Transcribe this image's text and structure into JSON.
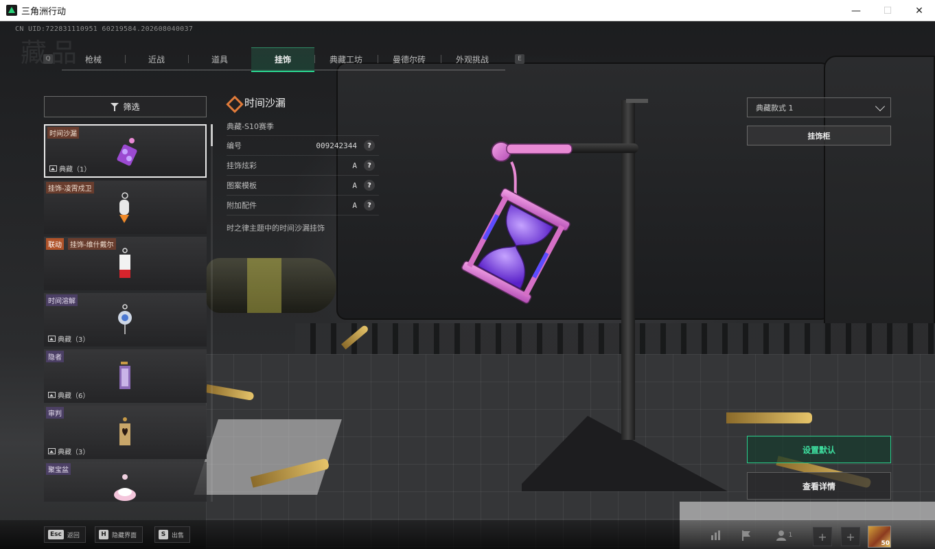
{
  "window": {
    "title": "三角洲行动"
  },
  "header": {
    "uid": "CN UID:722831110951 60219584.202608040037",
    "page_label": "藏品"
  },
  "tabs": {
    "prev_key": "Q",
    "next_key": "E",
    "items": [
      {
        "label": "枪械",
        "active": false
      },
      {
        "label": "近战",
        "active": false
      },
      {
        "label": "道具",
        "active": false
      },
      {
        "label": "挂饰",
        "active": true
      },
      {
        "label": "典藏工坊",
        "active": false
      },
      {
        "label": "曼德尔砖",
        "active": false
      },
      {
        "label": "外观挑战",
        "active": false
      }
    ]
  },
  "filter": {
    "label": "筛选"
  },
  "list": {
    "items": [
      {
        "name": "时间沙漏",
        "badge": "典藏（1）",
        "selected": true
      },
      {
        "name": "挂饰-凌霄戍卫",
        "badge": ""
      },
      {
        "tag": "联动",
        "name": "挂饰-维什戴尔",
        "badge": ""
      },
      {
        "name": "时间溶解",
        "badge": "典藏（3）"
      },
      {
        "name": "隐者",
        "badge": "典藏（6）"
      },
      {
        "name": "审判",
        "badge": "典藏（3）"
      },
      {
        "name": "聚宝盆",
        "badge": ""
      }
    ]
  },
  "detail": {
    "title": "时间沙漏",
    "season": "典藏-S10赛季",
    "rows": [
      {
        "label": "编号",
        "value": "009242344"
      },
      {
        "label": "挂饰炫彩",
        "value": "A"
      },
      {
        "label": "图案模板",
        "value": "A"
      },
      {
        "label": "附加配件",
        "value": "A"
      }
    ],
    "help_symbol": "?",
    "description": "时之律主题中的时间沙漏挂饰"
  },
  "right_panel": {
    "style_select": "典藏款式 1",
    "cabinet_button": "挂饰柜",
    "set_default_button": "设置默认",
    "view_details_button": "查看详情"
  },
  "bottom_bar": {
    "hints": [
      {
        "key": "Esc",
        "label": "返回"
      },
      {
        "key": "H",
        "label": "隐藏界面"
      },
      {
        "key": "S",
        "label": "出售"
      }
    ],
    "party_count": "1",
    "avatar_level": "50"
  },
  "colors": {
    "accent_green": "#2bdc94",
    "tag_orange": "#b0532a",
    "detail_icon": "#e07b3a"
  }
}
